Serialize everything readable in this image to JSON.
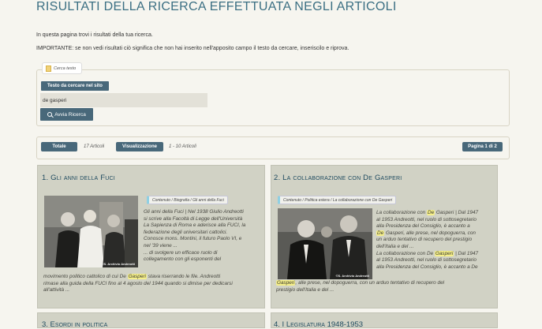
{
  "page": {
    "title": "RISULTATI DELLA RICERCA EFFETTUATA NEGLI ARTICOLI",
    "intro": "In questa pagina trovi i risultati della tua ricerca.",
    "important": "IMPORTANTE: se non vedi risultati ciò significa che non hai inserito nell'apposito campo il testo da cercare, inseriscilo e riprova."
  },
  "search": {
    "legend": "Cerca testo",
    "field_label": "Testo da cercare nel sito",
    "value": "de gasperi",
    "button_label": "Avvia Ricerca"
  },
  "stats": {
    "total_label": "Totale",
    "total_value": "17 Articoli",
    "view_label": "Visualizzazione",
    "view_value": "1 - 10 Articoli",
    "page_label": "Pagina 1 di 2"
  },
  "results": [
    {
      "title": "1. Gli anni della Fuci",
      "crumb": "Contenuto / Biografia / Gli anni della Fuci",
      "watermark": "©S. Archivio Andreotti",
      "lines_right": [
        "Gli anni della Fuci | Nel 1938 Giulio Andreotti",
        "si scrive alla Facoltà di Legge dell'Università",
        "La Sapienza di Roma e aderisce alla FUCI, la",
        "federazione degli universitari cattolici.",
        "Conosce mons. Montini, il futuro Paolo VI, e",
        "nel '39 viene ...",
        "... di svolgere un efficace ruolo di",
        "collegamento con gli esponenti del"
      ],
      "line_full_a": "movimento politico cattolico di cui De ",
      "line_full_hl": "Gasperi",
      "line_full_b": " stava riserrando le file. Andreotti",
      "line_full_2": "rimase alla guida della FUCI fino al 4 agosto del 1944 quando si dimise per dedicarsi",
      "line_full_3": "all'attività ..."
    },
    {
      "title": "2. La collaborazione con De Gasperi",
      "crumb": "Contenuto / Politica estera / La collaborazione con De Gasperi",
      "watermark": "©S. Archivio Andreotti",
      "l1a": "La collaborazione con ",
      "l1hl1": "De",
      "l1hl2": "Gasperi",
      "l1b": " | Dal 1947",
      "l2": "al 1953 Andreotti, nel ruolo di sottosegretario",
      "l3": "alla Presidenza del Consiglio, è accanto a",
      "l4hl": "De",
      "l4b": " Gasperi, alle prese, nel dopoguerra, con",
      "l5": "un arduo tentativo di recupero del prestigio",
      "l6": "dell'Italia e del ...",
      "l7a": "La collaborazione con De ",
      "l7hl": "Gasperi",
      "l7b": " | Dal 1947",
      "l8": "al 1953 Andreotti, nel ruolo di sottosegretario",
      "l9": "alla Presidenza del Consiglio, è accanto a De",
      "l10hl": "Gasperi",
      "l10b": ", alle prese, nel dopoguerra, con un arduo tentativo di recupero del",
      "l11": "prestigio dell'Italia e del ..."
    }
  ],
  "next_titles": [
    "3. Esordi in politica",
    "4. I Legislatura 1948-1953"
  ],
  "colors": {
    "accent": "#48687a",
    "title": "#3b6f83",
    "card": "#d1d2c5",
    "highlight": "#f5ef8a"
  }
}
